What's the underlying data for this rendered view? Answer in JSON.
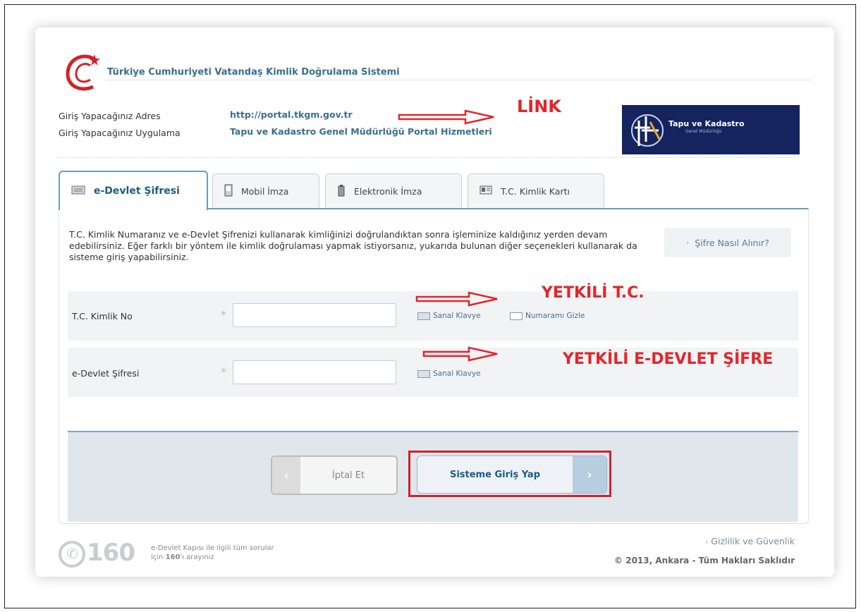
{
  "header": {
    "title": "Türkiye Cumhuriyeti Vatandaş Kimlik Doğrulama Sistemi"
  },
  "info": {
    "address_label": "Giriş Yapacağınız Adres",
    "address_value": "http://portal.tkgm.gov.tr",
    "app_label": "Giriş Yapacağınız Uygulama",
    "app_value": "Tapu ve Kadastro Genel Müdürlüğü Portal Hizmetleri"
  },
  "banner": {
    "title": "Tapu ve Kadastro",
    "subtitle": "Genel Müdürlüğü"
  },
  "annotations": {
    "link": "LİNK",
    "tc": "YETKİLİ T.C.",
    "password": "YETKİLİ E-DEVLET ŞİFRE",
    "color": "#e1262b"
  },
  "tabs": [
    {
      "label": "e-Devlet Şifresi",
      "icon": "keyboard-icon"
    },
    {
      "label": "Mobil İmza",
      "icon": "mobile-phone-icon"
    },
    {
      "label": "Elektronik İmza",
      "icon": "usb-token-icon"
    },
    {
      "label": "T.C. Kimlik Kartı",
      "icon": "id-card-icon"
    }
  ],
  "panel": {
    "description": "T.C. Kimlik Numaranız ve e-Devlet Şifrenizi kullanarak kimliğinizi doğrulandıktan sonra işleminize kaldığınız yerden devam edebilirsiniz. Eğer farklı bir yöntem ile kimlik doğrulaması yapmak istiyorsanız, yukarıda bulunan diğer seçenekleri kullanarak da sisteme giriş yapabilirsiniz.",
    "help_link": "Şifre Nasıl Alınır?"
  },
  "form": {
    "tc_label": "T.C. Kimlik No",
    "tc_value": "",
    "password_label": "e-Devlet Şifresi",
    "password_value": "",
    "required_mark": "*",
    "virtual_keyboard": "Sanal Klavye",
    "hide_number": "Numaramı Gizle"
  },
  "buttons": {
    "cancel": "İptal Et",
    "login": "Sisteme Giriş Yap",
    "prev_arrow": "‹",
    "next_arrow": "›"
  },
  "footer": {
    "hotline": "160",
    "hotline_text_1": "e-Devlet Kapısı ile ilgili tüm sorular",
    "hotline_text_2_pre": "için",
    "hotline_text_2_num": "160",
    "hotline_text_2_post": "'ı arayınız",
    "privacy_link": "Gizlilik ve Güvenlik",
    "copyright": "© 2013, Ankara - Tüm Hakları Saklıdır"
  }
}
